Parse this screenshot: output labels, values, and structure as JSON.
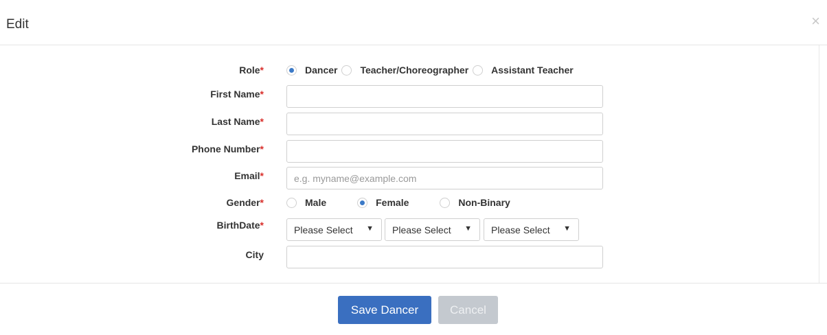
{
  "dialog": {
    "title": "Edit",
    "close_glyph": "×"
  },
  "form": {
    "role": {
      "label": "Role",
      "required_mark": "*",
      "options": [
        "Dancer",
        "Teacher/Choreographer",
        "Assistant Teacher"
      ],
      "selected": "Dancer"
    },
    "first_name": {
      "label": "First Name",
      "required_mark": "*",
      "value": "",
      "placeholder": ""
    },
    "last_name": {
      "label": "Last Name",
      "required_mark": "*",
      "value": "",
      "placeholder": ""
    },
    "phone": {
      "label": "Phone Number",
      "required_mark": "*",
      "value": "",
      "placeholder": ""
    },
    "email": {
      "label": "Email",
      "required_mark": "*",
      "value": "",
      "placeholder": "e.g. myname@example.com"
    },
    "gender": {
      "label": "Gender",
      "required_mark": "*",
      "options": [
        "Male",
        "Female",
        "Non-Binary"
      ],
      "selected": "Female"
    },
    "birthdate": {
      "label": "BirthDate",
      "required_mark": "*",
      "selects": [
        "Please Select",
        "Please Select",
        "Please Select"
      ]
    },
    "city": {
      "label": "City",
      "value": "",
      "placeholder": ""
    }
  },
  "footer": {
    "save_label": "Save Dancer",
    "cancel_label": "Cancel"
  },
  "colors": {
    "primary": "#3a6fc0",
    "radio_checked": "#3c7ac7",
    "required": "#d9302c",
    "cancel_bg": "#c4c9cf"
  },
  "icons": {
    "close": "close-icon",
    "caret": "caret-down-icon"
  }
}
